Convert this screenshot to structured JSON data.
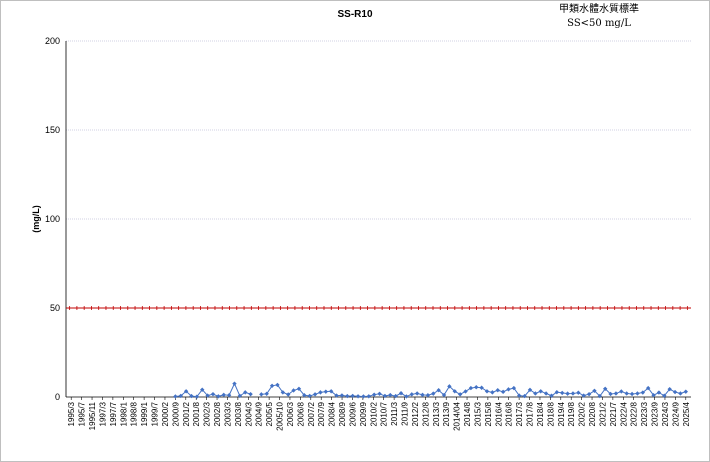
{
  "chart_data": {
    "type": "line",
    "title": "SS-R10",
    "standard_note_line1": "甲類水體水質標準",
    "standard_note_line2": "SS<50  mg/L",
    "ylabel": "(mg/L)",
    "xlabel": "",
    "ylim": [
      0,
      200
    ],
    "yticks": [
      0,
      50,
      100,
      150,
      200
    ],
    "grid": true,
    "x_tick_labels": [
      "1995/3",
      "1995/7",
      "1995/11",
      "1997/3",
      "1997/7",
      "1998/1",
      "1998/8",
      "1999/1",
      "1999/7",
      "2000/2",
      "2000/9",
      "2001/2",
      "2001/8",
      "2002/3",
      "2002/8",
      "2003/3",
      "2003/8",
      "2004/3",
      "2004/9",
      "2005/5",
      "2005/10",
      "2006/3",
      "2006/8",
      "2007/2",
      "2007/9",
      "2008/4",
      "2008/9",
      "2009/6",
      "2009/9",
      "2010/2",
      "2010/7",
      "2011/3",
      "2011/9",
      "2012/2",
      "2012/8",
      "2013/3",
      "2013/9",
      "2014/04",
      "2014/8",
      "2015/3",
      "2015/8",
      "2016/4",
      "2016/8",
      "2017/3",
      "2017/8",
      "2018/4",
      "2018/8",
      "2019/4",
      "2019/8",
      "2020/2",
      "2020/8",
      "2021/2",
      "2021/7",
      "2022/4",
      "2022/8",
      "2023/3",
      "2023/9",
      "2024/3",
      "2024/9",
      "2025/4"
    ],
    "series": [
      {
        "name": "",
        "color": "#4472c4",
        "marker": "diamond",
        "start_tick_index": 10,
        "values": [
          0.3,
          0.6,
          3.2,
          0.5,
          0.2,
          4.1,
          0.8,
          1.6,
          0.4,
          1.2,
          1.0,
          7.5,
          0.6,
          2.6,
          1.6,
          null,
          1.5,
          1.8,
          6.3,
          6.8,
          2.6,
          1.4,
          3.7,
          4.6,
          1.0,
          0.6,
          1.5,
          2.6,
          3.0,
          3.2,
          0.8,
          0.9,
          0.5,
          0.6,
          0.4,
          0.3,
          0.4,
          1.3,
          1.8,
          0.6,
          1.1,
          0.5,
          2.1,
          0.3,
          1.5,
          2.0,
          1.2,
          1.0,
          1.9,
          3.8,
          1.1,
          6.0,
          3.2,
          1.5,
          3.1,
          5.0,
          5.5,
          5.2,
          3.2,
          2.6,
          3.8,
          2.9,
          4.3,
          5.0,
          0.8,
          0.5,
          4.0,
          2.0,
          3.2,
          2.0,
          0.7,
          2.7,
          2.3,
          1.9,
          2.0,
          2.4,
          0.8,
          1.6,
          3.5,
          0.5,
          4.6,
          1.7,
          2.0,
          3.1,
          2.0,
          1.7,
          2.0,
          2.5,
          5.0,
          1.0,
          2.5,
          0.7,
          4.4,
          2.8,
          2.0,
          3.0
        ]
      },
      {
        "name": "",
        "color": "#c00000",
        "marker": "plus",
        "constant_value": 50,
        "point_count": 86
      }
    ]
  }
}
